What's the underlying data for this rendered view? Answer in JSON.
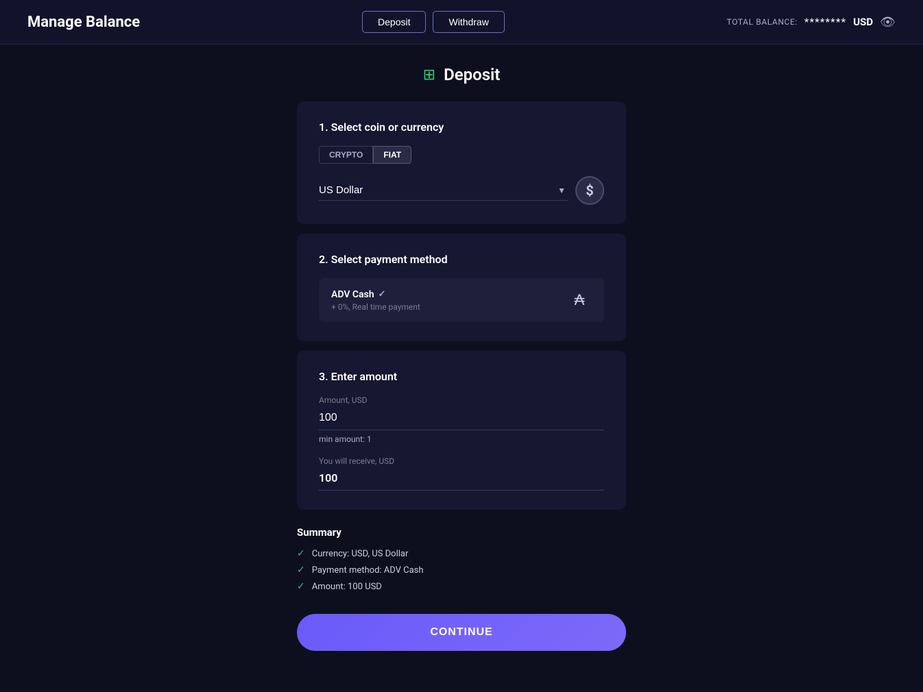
{
  "header": {
    "title": "Manage Balance",
    "deposit_label": "Deposit",
    "withdraw_label": "Withdraw",
    "balance_label": "TOTAL BALANCE:",
    "balance_value": "********",
    "balance_currency": "USD"
  },
  "deposit": {
    "page_title": "Deposit",
    "step1": {
      "title": "1. Select coin or currency",
      "tab_crypto": "CRYPTO",
      "tab_fiat": "FIAT",
      "selected_currency": "US Dollar",
      "currency_icon": "$"
    },
    "step2": {
      "title": "2. Select payment method",
      "method_name": "ADV Cash",
      "method_check": "✓",
      "method_sub": "+ 0%, Real time payment",
      "method_icon": "₳"
    },
    "step3": {
      "title": "3. Enter amount",
      "amount_label": "Amount, USD",
      "amount_value": "100",
      "min_label": "min amount:",
      "min_value": "1",
      "receive_label": "You will receive, USD",
      "receive_value": "100"
    },
    "summary": {
      "title": "Summary",
      "items": [
        "Currency: USD, US Dollar",
        "Payment method: ADV Cash",
        "Amount: 100 USD"
      ]
    },
    "continue_label": "CONTINUE"
  }
}
